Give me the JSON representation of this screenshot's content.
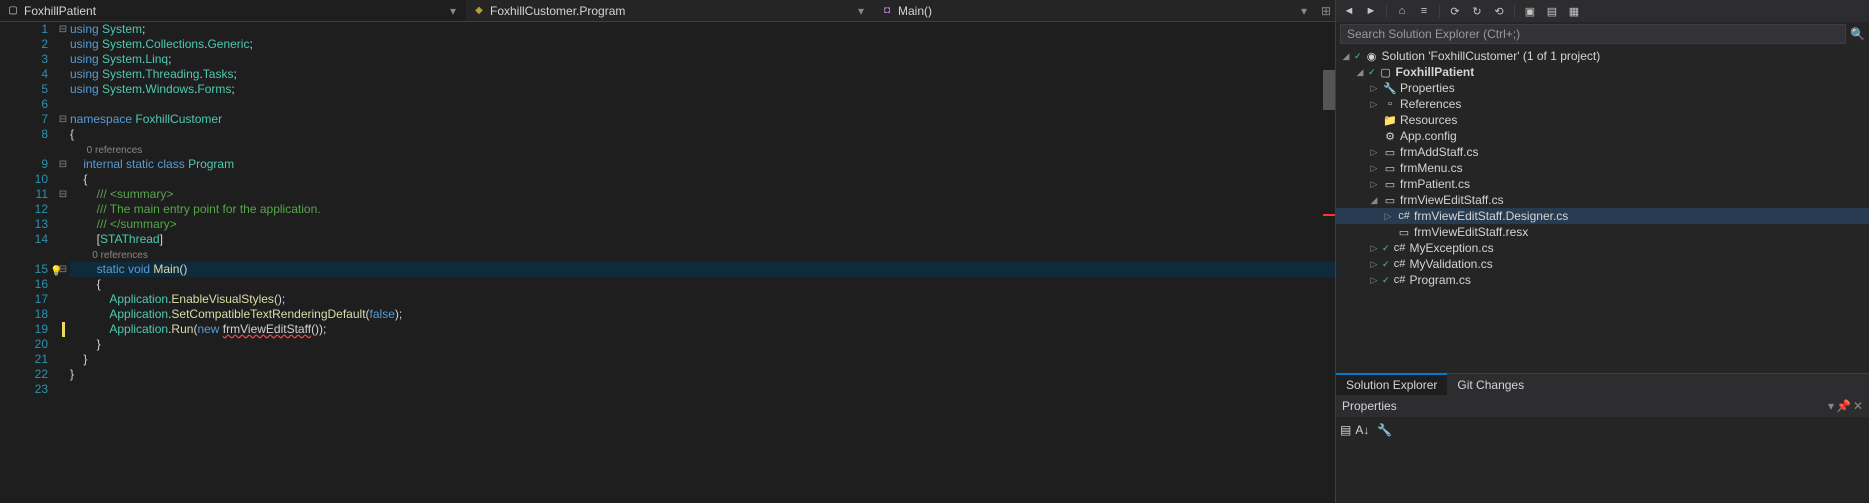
{
  "nav": {
    "seg1": {
      "label": "FoxhillPatient"
    },
    "seg2": {
      "label": "FoxhillCustomer.Program"
    },
    "seg3": {
      "label": "Main()"
    }
  },
  "code": {
    "lines": [
      {
        "n": "1",
        "f": "⊟",
        "t": [
          [
            "kw",
            "using "
          ],
          [
            "type",
            "System"
          ],
          [
            "punct",
            ";"
          ]
        ]
      },
      {
        "n": "2",
        "f": "",
        "t": [
          [
            "kw",
            "using "
          ],
          [
            "type",
            "System"
          ],
          [
            "punct",
            "."
          ],
          [
            "type",
            "Collections"
          ],
          [
            "punct",
            "."
          ],
          [
            "type",
            "Generic"
          ],
          [
            "punct",
            ";"
          ]
        ]
      },
      {
        "n": "3",
        "f": "",
        "t": [
          [
            "kw",
            "using "
          ],
          [
            "type",
            "System"
          ],
          [
            "punct",
            "."
          ],
          [
            "type",
            "Linq"
          ],
          [
            "punct",
            ";"
          ]
        ]
      },
      {
        "n": "4",
        "f": "",
        "t": [
          [
            "kw",
            "using "
          ],
          [
            "type",
            "System"
          ],
          [
            "punct",
            "."
          ],
          [
            "type",
            "Threading"
          ],
          [
            "punct",
            "."
          ],
          [
            "type",
            "Tasks"
          ],
          [
            "punct",
            ";"
          ]
        ]
      },
      {
        "n": "5",
        "f": "",
        "t": [
          [
            "kw",
            "using "
          ],
          [
            "type",
            "System"
          ],
          [
            "punct",
            "."
          ],
          [
            "type",
            "Windows"
          ],
          [
            "punct",
            "."
          ],
          [
            "type",
            "Forms"
          ],
          [
            "punct",
            ";"
          ]
        ]
      },
      {
        "n": "6",
        "f": "",
        "t": []
      },
      {
        "n": "7",
        "f": "⊟",
        "t": [
          [
            "kw",
            "namespace "
          ],
          [
            "type",
            "FoxhillCustomer"
          ]
        ]
      },
      {
        "n": "8",
        "f": "",
        "t": [
          [
            "punct",
            "{"
          ]
        ]
      },
      {
        "n": "",
        "f": "",
        "ref": true,
        "t": [
          [
            "ref",
            "      0 references"
          ]
        ]
      },
      {
        "n": "9",
        "f": "⊟",
        "t": [
          [
            "punct",
            "    "
          ],
          [
            "kw",
            "internal static class "
          ],
          [
            "type",
            "Program"
          ]
        ]
      },
      {
        "n": "10",
        "f": "",
        "t": [
          [
            "punct",
            "    {"
          ]
        ]
      },
      {
        "n": "11",
        "f": "⊟",
        "t": [
          [
            "punct",
            "        "
          ],
          [
            "cm",
            "/// <summary>"
          ]
        ]
      },
      {
        "n": "12",
        "f": "",
        "t": [
          [
            "punct",
            "        "
          ],
          [
            "cm",
            "/// The main entry point for the application."
          ]
        ]
      },
      {
        "n": "13",
        "f": "",
        "t": [
          [
            "punct",
            "        "
          ],
          [
            "cm",
            "/// </summary>"
          ]
        ]
      },
      {
        "n": "14",
        "f": "",
        "t": [
          [
            "punct",
            "        ["
          ],
          [
            "attr",
            "STAThread"
          ],
          [
            "punct",
            "]"
          ]
        ]
      },
      {
        "n": "",
        "f": "",
        "ref": true,
        "t": [
          [
            "ref",
            "        0 references"
          ]
        ]
      },
      {
        "n": "15",
        "f": "⊟",
        "hl": true,
        "bulb": true,
        "t": [
          [
            "punct",
            "        "
          ],
          [
            "kw",
            "static void "
          ],
          [
            "ident",
            "Main"
          ],
          [
            "punct",
            "()"
          ]
        ]
      },
      {
        "n": "16",
        "f": "",
        "t": [
          [
            "punct",
            "        {"
          ]
        ]
      },
      {
        "n": "17",
        "f": "",
        "t": [
          [
            "punct",
            "            "
          ],
          [
            "type",
            "Application"
          ],
          [
            "punct",
            "."
          ],
          [
            "ident",
            "EnableVisualStyles"
          ],
          [
            "punct",
            "();"
          ]
        ]
      },
      {
        "n": "18",
        "f": "",
        "t": [
          [
            "punct",
            "            "
          ],
          [
            "type",
            "Application"
          ],
          [
            "punct",
            "."
          ],
          [
            "ident",
            "SetCompatibleTextRenderingDefault"
          ],
          [
            "punct",
            "("
          ],
          [
            "kw",
            "false"
          ],
          [
            "punct",
            ");"
          ]
        ]
      },
      {
        "n": "19",
        "f": "",
        "ybar": true,
        "t": [
          [
            "punct",
            "            "
          ],
          [
            "type",
            "Application"
          ],
          [
            "punct",
            "."
          ],
          [
            "ident",
            "Run"
          ],
          [
            "punct",
            "("
          ],
          [
            "kw",
            "new "
          ],
          [
            "err",
            "frmViewEditStaff"
          ],
          [
            "punct",
            "());"
          ]
        ]
      },
      {
        "n": "20",
        "f": "",
        "t": [
          [
            "punct",
            "        }"
          ]
        ]
      },
      {
        "n": "21",
        "f": "",
        "t": [
          [
            "punct",
            "    }"
          ]
        ]
      },
      {
        "n": "22",
        "f": "",
        "t": [
          [
            "punct",
            "}"
          ]
        ]
      },
      {
        "n": "23",
        "f": "",
        "t": []
      }
    ]
  },
  "solutionExplorer": {
    "searchPlaceholder": "Search Solution Explorer (Ctrl+;)",
    "tree": [
      {
        "d": 0,
        "exp": "◢",
        "icon": "◉",
        "checked": true,
        "label": "Solution 'FoxhillCustomer' (1 of 1 project)"
      },
      {
        "d": 1,
        "exp": "◢",
        "icon": "▢",
        "checked": true,
        "bold": true,
        "label": "FoxhillPatient"
      },
      {
        "d": 2,
        "exp": "▷",
        "icon": "🔧",
        "label": "Properties"
      },
      {
        "d": 2,
        "exp": "▷",
        "icon": "▫",
        "label": "References"
      },
      {
        "d": 2,
        "exp": "",
        "icon": "📁",
        "label": "Resources"
      },
      {
        "d": 2,
        "exp": "",
        "icon": "⚙",
        "label": "App.config"
      },
      {
        "d": 2,
        "exp": "▷",
        "icon": "▭",
        "label": "frmAddStaff.cs"
      },
      {
        "d": 2,
        "exp": "▷",
        "icon": "▭",
        "label": "frmMenu.cs"
      },
      {
        "d": 2,
        "exp": "▷",
        "icon": "▭",
        "label": "frmPatient.cs"
      },
      {
        "d": 2,
        "exp": "◢",
        "icon": "▭",
        "label": "frmViewEditStaff.cs"
      },
      {
        "d": 3,
        "exp": "▷",
        "icon": "c#",
        "label": "frmViewEditStaff.Designer.cs",
        "sel": true
      },
      {
        "d": 3,
        "exp": "",
        "icon": "▭",
        "label": "frmViewEditStaff.resx"
      },
      {
        "d": 2,
        "exp": "▷",
        "icon": "c#",
        "checked": true,
        "label": "MyException.cs"
      },
      {
        "d": 2,
        "exp": "▷",
        "icon": "c#",
        "checked": true,
        "label": "MyValidation.cs"
      },
      {
        "d": 2,
        "exp": "▷",
        "icon": "c#",
        "checked": true,
        "label": "Program.cs"
      }
    ],
    "tabs": {
      "active": "Solution Explorer",
      "other": "Git Changes"
    }
  },
  "properties": {
    "title": "Properties"
  }
}
